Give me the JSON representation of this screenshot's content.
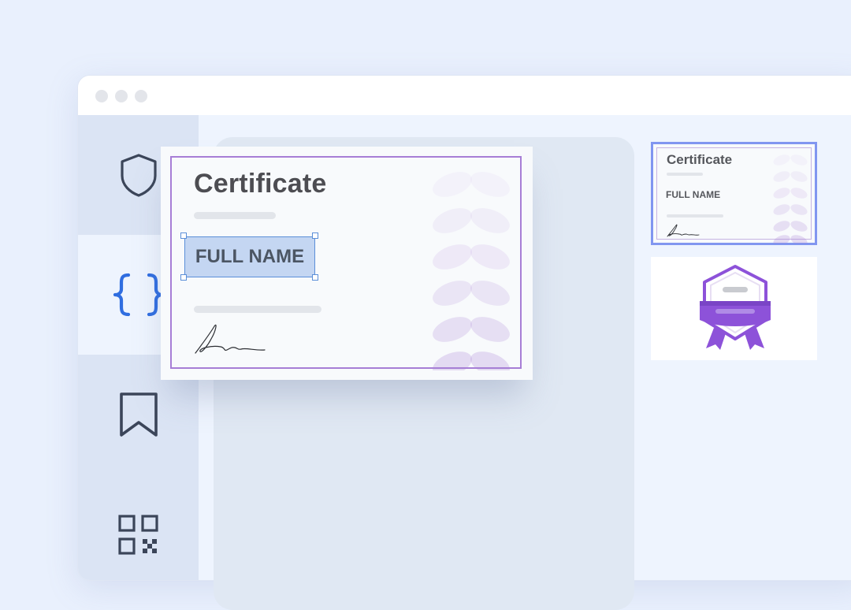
{
  "window": {
    "controls": [
      "window-dot",
      "window-dot",
      "window-dot"
    ]
  },
  "sidebar": {
    "items": [
      {
        "name": "sidebar-item-security",
        "icon": "shield-icon",
        "active": false
      },
      {
        "name": "sidebar-item-code",
        "icon": "braces-icon",
        "active": true
      },
      {
        "name": "sidebar-item-bookmark",
        "icon": "bookmark-icon",
        "active": false
      },
      {
        "name": "sidebar-item-qr",
        "icon": "qr-code-icon",
        "active": false
      }
    ]
  },
  "editor": {
    "certificate": {
      "title": "Certificate",
      "name_field": "FULL NAME",
      "signature_icon": "signature-icon",
      "decoration_icon": "laurel-icon"
    }
  },
  "templates": {
    "items": [
      {
        "title": "Certificate",
        "name": "FULL NAME",
        "selected": true
      },
      {
        "icon": "badge-icon",
        "selected": false
      }
    ]
  },
  "colors": {
    "accent_purple": "#a77ed6",
    "selection_blue": "#5b8fd8",
    "active_icon_blue": "#2f6de0",
    "icon_dark": "#3b4559",
    "badge_purple": "#8d52d9"
  }
}
